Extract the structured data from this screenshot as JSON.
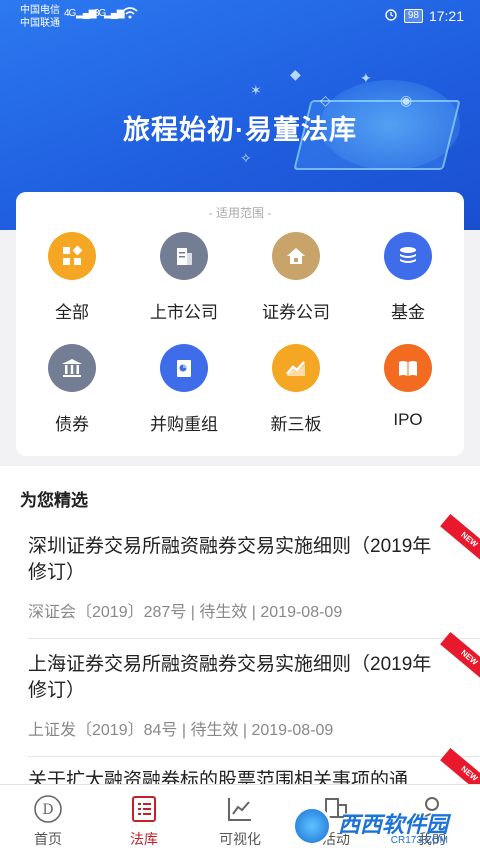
{
  "status_bar": {
    "carrier_1": "中国电信",
    "carrier_2": "中国联通",
    "signal_1": "4G",
    "signal_2": "3G",
    "battery": "98",
    "time": "17:21"
  },
  "hero": {
    "title": "旅程始初·易董法库"
  },
  "scope": {
    "caption": "- 适用范围 -",
    "categories": [
      {
        "label": "全部",
        "icon": "grid-icon",
        "color": "#f5a623"
      },
      {
        "label": "上市公司",
        "icon": "building-icon",
        "color": "#737d93"
      },
      {
        "label": "证券公司",
        "icon": "house-icon",
        "color": "#c8a46a"
      },
      {
        "label": "基金",
        "icon": "coins-stack-icon",
        "color": "#3f6de9"
      },
      {
        "label": "债券",
        "icon": "bank-icon",
        "color": "#737d93"
      },
      {
        "label": "并购重组",
        "icon": "document-chart-icon",
        "color": "#3f6de9"
      },
      {
        "label": "新三板",
        "icon": "trend-chart-icon",
        "color": "#f5a623"
      },
      {
        "label": "IPO",
        "icon": "book-icon",
        "color": "#f36b21"
      }
    ]
  },
  "featured": {
    "title": "为您精选",
    "articles": [
      {
        "title": "深圳证券交易所融资融券交易实施细则（2019年修订）",
        "meta": "深证会〔2019〕287号 | 待生效 | 2019-08-09",
        "badge": "NEW"
      },
      {
        "title": "上海证券交易所融资融券交易实施细则（2019年修订）",
        "meta": "上证发〔2019〕84号 | 待生效 | 2019-08-09",
        "badge": "NEW"
      },
      {
        "title": "关于扩大融资融券标的股票范围相关事项的通",
        "meta": "",
        "badge": "NEW"
      }
    ]
  },
  "tabbar": {
    "tabs": [
      {
        "label": "首页",
        "icon": "home-logo-icon"
      },
      {
        "label": "法库",
        "icon": "list-icon",
        "active": true
      },
      {
        "label": "可视化",
        "icon": "chart-icon"
      },
      {
        "label": "活动",
        "icon": "activity-icon"
      },
      {
        "label": "我的",
        "icon": "user-icon"
      }
    ],
    "active_color": "#c3202a"
  },
  "watermark": {
    "main": "西西软件园",
    "sub": "CR173.COM"
  }
}
